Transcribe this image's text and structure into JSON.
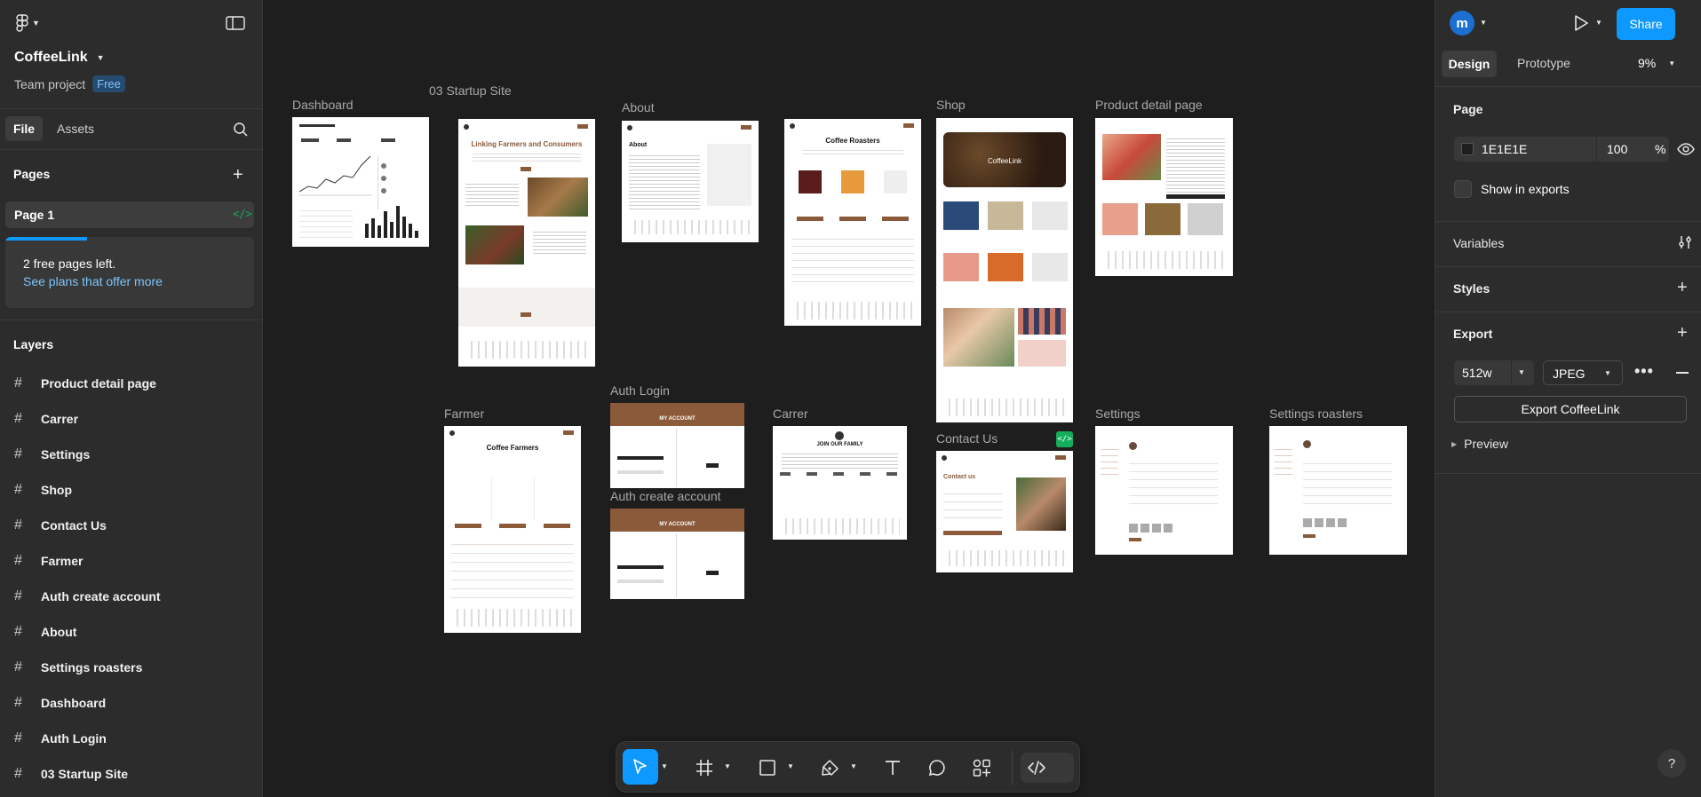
{
  "app": {
    "file_name": "CoffeeLink",
    "team_project": "Team project",
    "plan_badge": "Free"
  },
  "left_panel": {
    "tabs": [
      "File",
      "Assets"
    ],
    "pages_title": "Pages",
    "current_page": "Page 1",
    "free_pages_notice": "2 free pages left.",
    "plans_link": "See plans that offer more",
    "layers_title": "Layers",
    "layers": [
      "Product detail page",
      "Carrer",
      "Settings",
      "Shop",
      "Contact Us",
      "Farmer",
      "Auth create account",
      "About",
      "Settings roasters",
      "Dashboard",
      "Auth Login",
      "03 Startup Site"
    ]
  },
  "canvas": {
    "frames": {
      "dashboard": "Dashboard",
      "startup": "03 Startup Site",
      "about": "About",
      "carrer_top": "",
      "shop": "Shop",
      "product": "Product detail page",
      "farmer": "Farmer",
      "auth_login": "Auth Login",
      "auth_create": "Auth create account",
      "carrer": "Carrer",
      "contact": "Contact Us",
      "settings": "Settings",
      "settings_roasters": "Settings roasters"
    },
    "thumb_text": {
      "startup_heading": "Linking Farmers and Consumers",
      "coffee_roasters": "Coffee Roasters",
      "coffee_farmers": "Coffee Farmers",
      "my_account": "MY ACCOUNT",
      "join_family": "JOIN OUR FAMILY",
      "contact_us": "Contact us",
      "about_heading": "About",
      "coffeelink_banner": "CoffeeLink"
    }
  },
  "right_panel": {
    "avatar_initial": "m",
    "share_label": "Share",
    "tabs": [
      "Design",
      "Prototype"
    ],
    "zoom": "9%",
    "page_section": "Page",
    "bg_color_hex": "1E1E1E",
    "bg_opacity": "100",
    "percent_sign": "%",
    "show_in_exports": "Show in exports",
    "variables": "Variables",
    "styles": "Styles",
    "export": "Export",
    "export_scale": "512w",
    "export_format": "JPEG",
    "export_button": "Export CoffeeLink",
    "preview": "Preview"
  },
  "colors": {
    "accent_blue": "#0d99ff",
    "link_blue": "#7cc4fa",
    "badge_bg": "#264b6e",
    "green_dev": "#14ae5c",
    "coffee_brown": "#8a5a3b"
  },
  "icons": [
    "figma-menu-icon",
    "sidebar-toggle-icon",
    "search-icon",
    "plus-icon",
    "dev-mode-icon",
    "play-icon",
    "eye-icon",
    "adjust-icon",
    "move-tool-icon",
    "frame-tool-icon",
    "rectangle-tool-icon",
    "pen-tool-icon",
    "text-tool-icon",
    "comment-tool-icon",
    "actions-icon",
    "code-icon",
    "help-icon"
  ]
}
